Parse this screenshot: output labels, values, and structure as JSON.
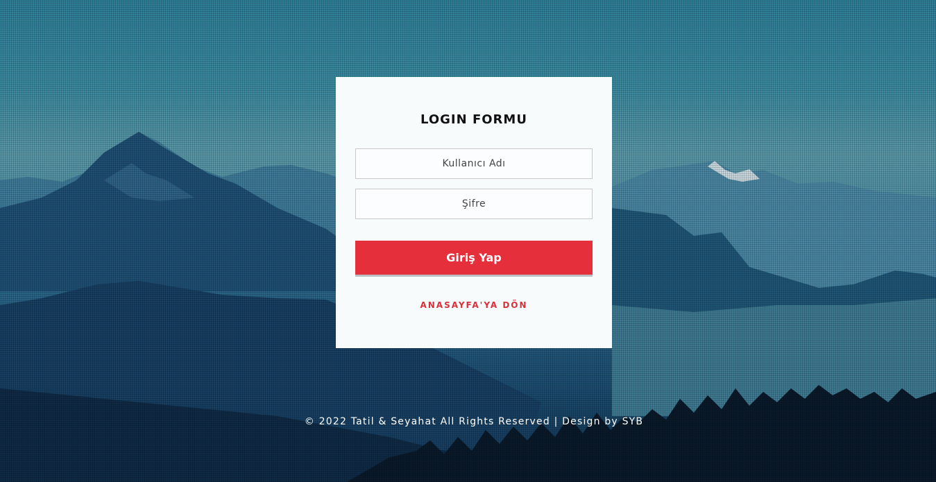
{
  "login": {
    "title": "LOGIN FORMU",
    "username_placeholder": "Kullanıcı Adı",
    "password_placeholder": "Şifre",
    "submit_label": "Giriş Yap",
    "home_link_label": "ANASAYFA'YA DÖN"
  },
  "footer": {
    "text": "© 2022 Tatil & Seyahat All Rights Reserved | Design by SYB"
  },
  "colors": {
    "accent": "#e5303b",
    "card_background": "#f8fbfc",
    "sky": "#3b8aa0",
    "mountains_dark": "#0f2f4c"
  }
}
